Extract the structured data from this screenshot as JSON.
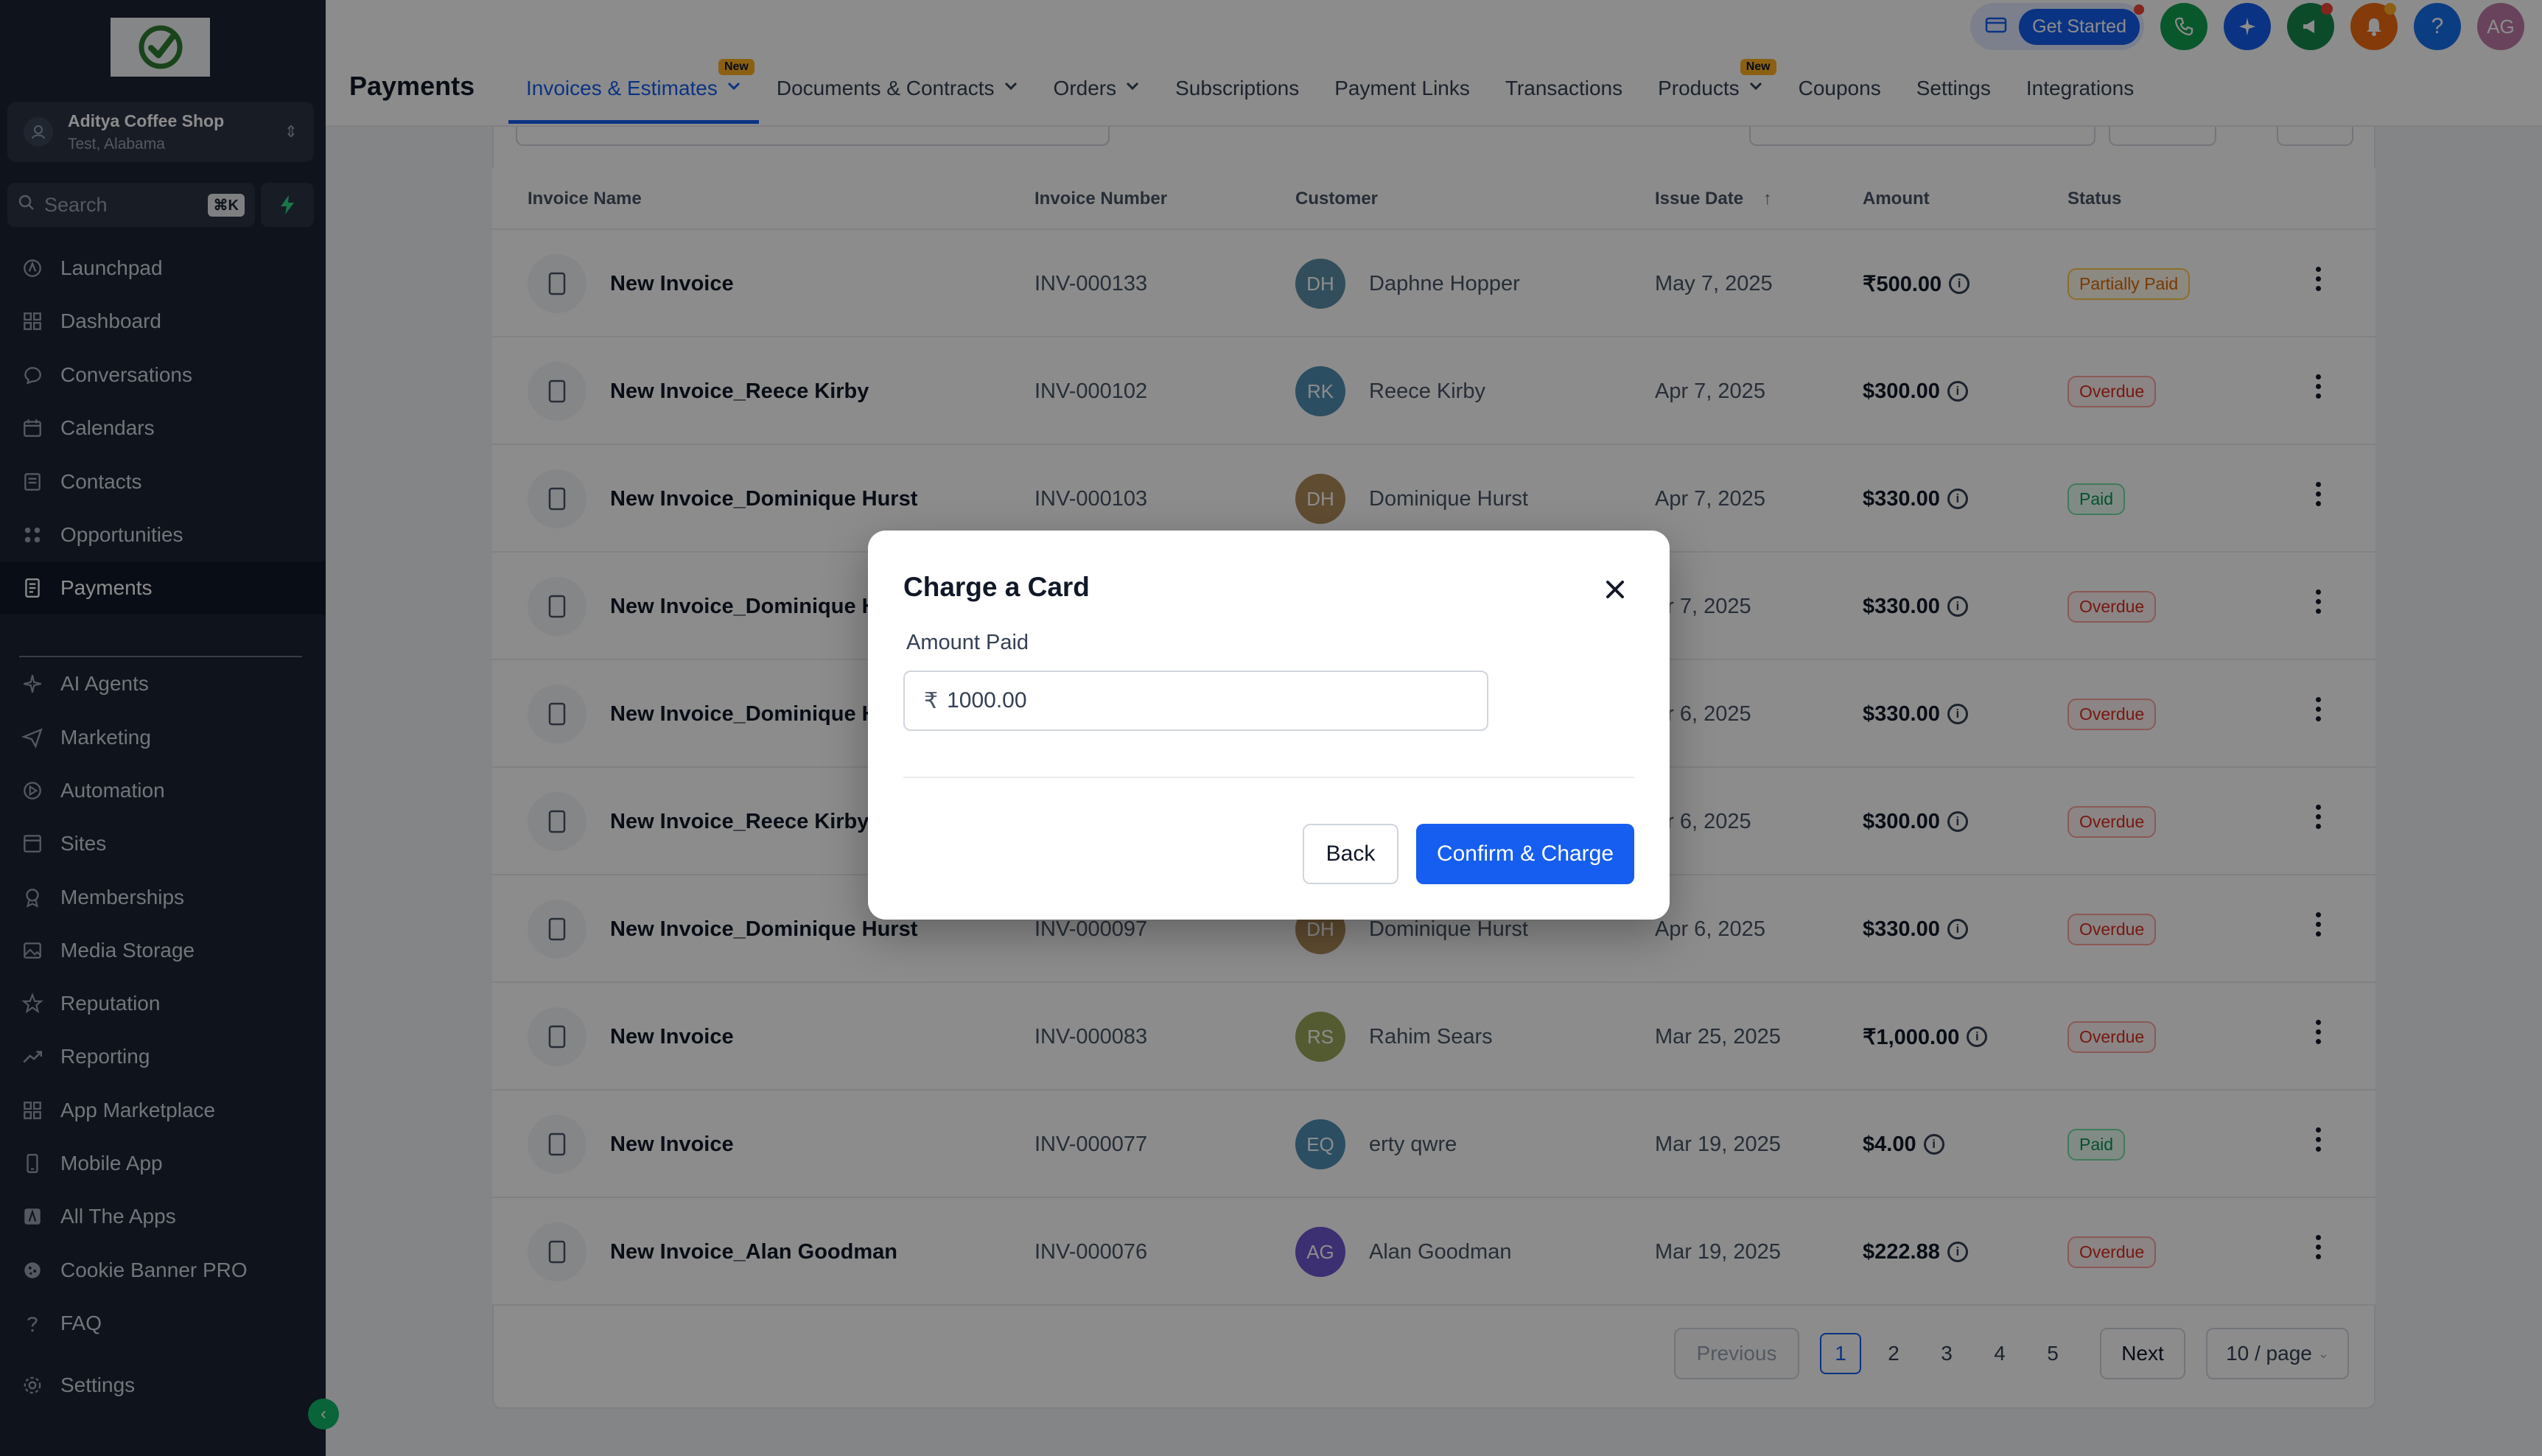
{
  "sidebar": {
    "account": {
      "name": "Aditya Coffee Shop",
      "location": "Test, Alabama"
    },
    "search": {
      "placeholder": "Search",
      "shortcut": "⌘K"
    },
    "items": [
      {
        "label": "Launchpad",
        "icon": "launchpad-icon"
      },
      {
        "label": "Dashboard",
        "icon": "dashboard-icon"
      },
      {
        "label": "Conversations",
        "icon": "chat-icon"
      },
      {
        "label": "Calendars",
        "icon": "calendar-icon"
      },
      {
        "label": "Contacts",
        "icon": "contacts-icon"
      },
      {
        "label": "Opportunities",
        "icon": "opportunities-icon"
      },
      {
        "label": "Payments",
        "icon": "payments-icon",
        "active": true
      },
      {
        "label": "AI Agents",
        "icon": "sparkle-icon"
      },
      {
        "label": "Marketing",
        "icon": "send-icon"
      },
      {
        "label": "Automation",
        "icon": "automation-icon"
      },
      {
        "label": "Sites",
        "icon": "sites-icon"
      },
      {
        "label": "Memberships",
        "icon": "memberships-icon"
      },
      {
        "label": "Media Storage",
        "icon": "image-icon"
      },
      {
        "label": "Reputation",
        "icon": "star-icon"
      },
      {
        "label": "Reporting",
        "icon": "trend-icon"
      },
      {
        "label": "App Marketplace",
        "icon": "grid-icon"
      },
      {
        "label": "Mobile App",
        "icon": "mobile-icon"
      },
      {
        "label": "All The Apps",
        "icon": "apps-icon"
      },
      {
        "label": "Cookie Banner PRO",
        "icon": "cookie-icon"
      },
      {
        "label": "FAQ",
        "icon": "question-icon"
      },
      {
        "label": "Settings",
        "icon": "gear-icon"
      }
    ]
  },
  "header": {
    "title": "Payments",
    "tabs": [
      {
        "label": "Invoices & Estimates",
        "badge": "New",
        "dropdown": true,
        "active": true
      },
      {
        "label": "Documents & Contracts",
        "dropdown": true
      },
      {
        "label": "Orders",
        "dropdown": true
      },
      {
        "label": "Subscriptions"
      },
      {
        "label": "Payment Links"
      },
      {
        "label": "Transactions"
      },
      {
        "label": "Products",
        "badge": "New",
        "dropdown": true
      },
      {
        "label": "Coupons"
      },
      {
        "label": "Settings"
      },
      {
        "label": "Integrations"
      }
    ],
    "get_started": "Get Started",
    "help_symbol": "?",
    "user_initials": "AG"
  },
  "table": {
    "columns": [
      "Invoice Name",
      "Invoice Number",
      "Customer",
      "Issue Date",
      "Amount",
      "Status"
    ],
    "rows": [
      {
        "name": "New Invoice",
        "number": "INV-000133",
        "initials": "DH",
        "customer": "Daphne Hopper",
        "date": "May 7, 2025",
        "amount": "₹500.00",
        "status": "Partially Paid",
        "avatar_color": "#5b8fa8"
      },
      {
        "name": "New Invoice_Reece Kirby",
        "number": "INV-000102",
        "initials": "RK",
        "customer": "Reece Kirby",
        "date": "Apr 7, 2025",
        "amount": "$300.00",
        "status": "Overdue",
        "avatar_color": "#4f8fb3"
      },
      {
        "name": "New Invoice_Dominique Hurst",
        "number": "INV-000103",
        "initials": "DH",
        "customer": "Dominique Hurst",
        "date": "Apr 7, 2025",
        "amount": "$330.00",
        "status": "Paid",
        "avatar_color": "#b08a5a"
      },
      {
        "name": "New Invoice_Dominique H",
        "number": "",
        "initials": "",
        "customer": "",
        "date": "pr 7, 2025",
        "amount": "$330.00",
        "status": "Overdue",
        "avatar_color": ""
      },
      {
        "name": "New Invoice_Dominique H",
        "number": "",
        "initials": "",
        "customer": "",
        "date": "pr 6, 2025",
        "amount": "$330.00",
        "status": "Overdue",
        "avatar_color": ""
      },
      {
        "name": "New Invoice_Reece Kirby",
        "number": "",
        "initials": "",
        "customer": "",
        "date": "pr 6, 2025",
        "amount": "$300.00",
        "status": "Overdue",
        "avatar_color": ""
      },
      {
        "name": "New Invoice_Dominique Hurst",
        "number": "INV-000097",
        "initials": "DH",
        "customer": "Dominique Hurst",
        "date": "Apr 6, 2025",
        "amount": "$330.00",
        "status": "Overdue",
        "avatar_color": "#b08a5a"
      },
      {
        "name": "New Invoice",
        "number": "INV-000083",
        "initials": "RS",
        "customer": "Rahim Sears",
        "date": "Mar 25, 2025",
        "amount": "₹1,000.00",
        "status": "Overdue",
        "avatar_color": "#9aa65a"
      },
      {
        "name": "New Invoice",
        "number": "INV-000077",
        "initials": "EQ",
        "customer": "erty qwre",
        "date": "Mar 19, 2025",
        "amount": "$4.00",
        "status": "Paid",
        "avatar_color": "#4f8fb3"
      },
      {
        "name": "New Invoice_Alan Goodman",
        "number": "INV-000076",
        "initials": "AG",
        "customer": "Alan Goodman",
        "date": "Mar 19, 2025",
        "amount": "$222.88",
        "status": "Overdue",
        "avatar_color": "#6e56cf"
      }
    ]
  },
  "pagination": {
    "previous": "Previous",
    "pages": [
      "1",
      "2",
      "3",
      "4",
      "5"
    ],
    "current": "1",
    "next": "Next",
    "page_size": "10 / page"
  },
  "modal": {
    "title": "Charge a Card",
    "amount_label": "Amount Paid",
    "currency": "₹",
    "amount_value": "1000.00",
    "back_label": "Back",
    "confirm_label": "Confirm & Charge"
  }
}
